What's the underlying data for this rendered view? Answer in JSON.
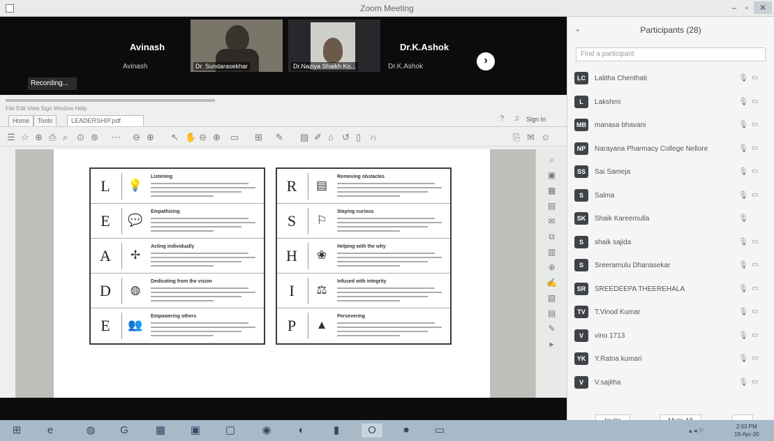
{
  "window": {
    "title": "Zoom Meeting"
  },
  "strip": {
    "p1": {
      "name": "Avinash",
      "sub": "Avinash"
    },
    "p2": {
      "label": "Dr. Sundarasekhar"
    },
    "p3": {
      "label": "Dr.Naziya Shaikh Ko..."
    },
    "p4": {
      "name": "Dr.K.Ashok",
      "sub": "Dr.K.Ashok"
    },
    "recording": "Recording..."
  },
  "browser": {
    "url_line": "File  Edit  View  Sign  Window  Help",
    "tab_home": "Home",
    "tab_tools": "Tools",
    "tab_doc": "LEADERSHIP.pdf",
    "signin": "Sign In"
  },
  "leadership": {
    "left": [
      {
        "letter": "L",
        "icon": "lightbulb-icon",
        "glyph": "💡",
        "title": "Listening"
      },
      {
        "letter": "E",
        "icon": "speech-bubble-icon",
        "glyph": "💬",
        "title": "Empathizing"
      },
      {
        "letter": "A",
        "icon": "compass-icon",
        "glyph": "✢",
        "title": "Acting individually"
      },
      {
        "letter": "D",
        "icon": "circle-icon",
        "glyph": "◍",
        "title": "Dedicating from the vision"
      },
      {
        "letter": "E",
        "icon": "people-icon",
        "glyph": "👥",
        "title": "Empowering others"
      }
    ],
    "right": [
      {
        "letter": "R",
        "icon": "barrier-icon",
        "glyph": "▤",
        "title": "Removing obstacles"
      },
      {
        "letter": "S",
        "icon": "teacher-icon",
        "glyph": "⚐",
        "title": "Staying curious"
      },
      {
        "letter": "H",
        "icon": "lotus-icon",
        "glyph": "❀",
        "title": "Helping with the why"
      },
      {
        "letter": "I",
        "icon": "scales-icon",
        "glyph": "⚖",
        "title": "Infused with integrity"
      },
      {
        "letter": "P",
        "icon": "mountain-icon",
        "glyph": "▲",
        "title": "Persevering"
      }
    ]
  },
  "participants": {
    "title": "Participants (28)",
    "search_placeholder": "Find a participant",
    "list": [
      {
        "initials": "LC",
        "name": "Lalitha Chenthati",
        "cam": true
      },
      {
        "initials": "L",
        "name": "Lakshmi",
        "cam": true
      },
      {
        "initials": "MB",
        "name": "manasa bhavani",
        "cam": true
      },
      {
        "initials": "NP",
        "name": "Narayana Pharmacy College Nellore",
        "cam": true
      },
      {
        "initials": "SS",
        "name": "Sai Sameja",
        "cam": true
      },
      {
        "initials": "S",
        "name": "Salma",
        "cam": true
      },
      {
        "initials": "SK",
        "name": "Shaik Kareemulla",
        "cam": false
      },
      {
        "initials": "S",
        "name": "shaik sajida",
        "cam": true
      },
      {
        "initials": "S",
        "name": "Sreeramulu Dhanasekar",
        "cam": true
      },
      {
        "initials": "SR",
        "name": "SREEDEEPA THEEREHALA",
        "cam": true
      },
      {
        "initials": "TV",
        "name": "T.Vinod Kumar",
        "cam": true
      },
      {
        "initials": "V",
        "name": "vino 1713",
        "cam": true
      },
      {
        "initials": "YK",
        "name": "Y.Ratna kumari",
        "cam": true
      },
      {
        "initials": "V",
        "name": "V.sajitha",
        "cam": true
      }
    ],
    "invite": "Invite",
    "mute_all": "Mute All",
    "more": "..."
  },
  "taskbar": {
    "time": "2:03 PM\n19-Apr-20"
  }
}
